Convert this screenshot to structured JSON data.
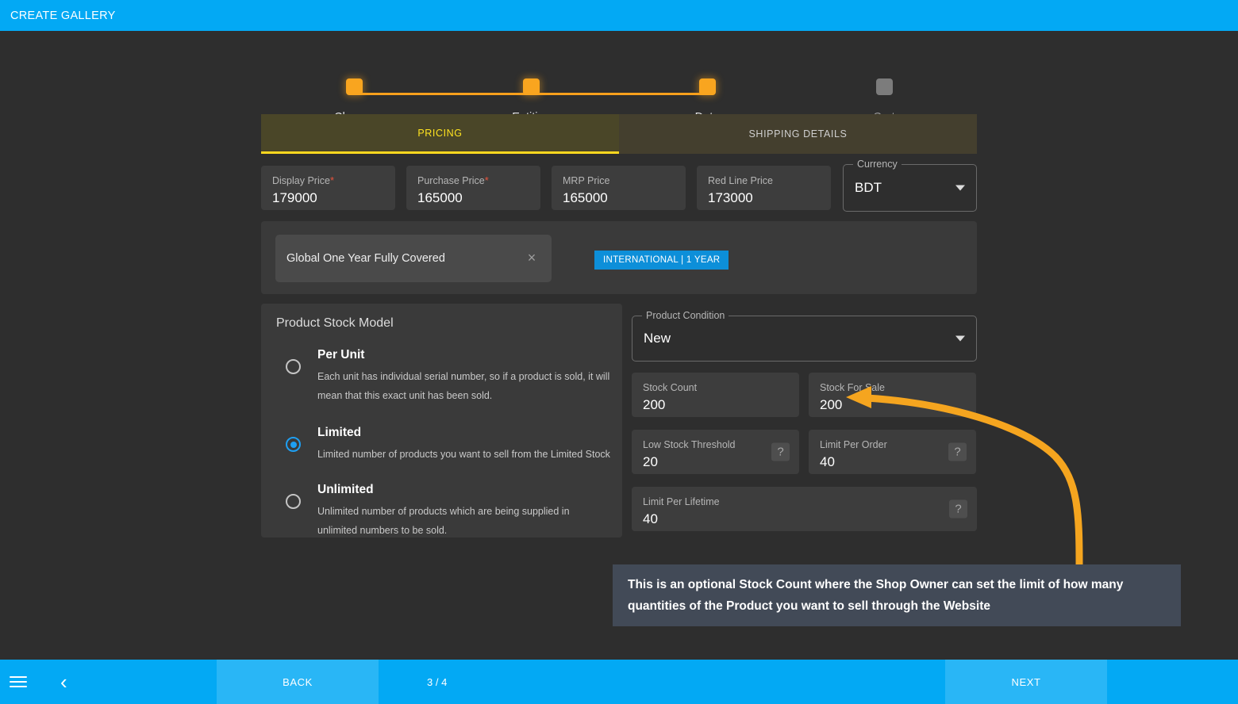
{
  "header": {
    "title": "CREATE GALLERY"
  },
  "stepper": {
    "steps": [
      {
        "label": "Choose",
        "state": "active"
      },
      {
        "label": "Entities",
        "state": "active"
      },
      {
        "label": "Data",
        "state": "active"
      },
      {
        "label": "Cart",
        "state": "inactive"
      }
    ]
  },
  "tabs": [
    {
      "label": "PRICING",
      "state": "active"
    },
    {
      "label": "SHIPPING DETAILS",
      "state": "inactive"
    }
  ],
  "pricing": {
    "display_price": {
      "label": "Display Price",
      "required": "*",
      "value": "179000"
    },
    "purchase_price": {
      "label": "Purchase Price",
      "required": "*",
      "value": "165000"
    },
    "mrp_price": {
      "label": "MRP Price",
      "value": "165000"
    },
    "red_line_price": {
      "label": "Red Line Price",
      "value": "173000"
    },
    "currency": {
      "label": "Currency",
      "value": "BDT"
    }
  },
  "warranty": {
    "chip_text": "Global One Year Fully Covered",
    "chip_close": "×",
    "badge": "INTERNATIONAL | 1 YEAR"
  },
  "stock_model": {
    "title": "Product Stock Model",
    "options": [
      {
        "title": "Per Unit",
        "description": "Each unit has individual serial number, so if a product is sold, it will mean that this exact unit has been sold.",
        "selected": false
      },
      {
        "title": "Limited",
        "description": "Limited number of products you want to sell from the Limited Stock",
        "selected": true
      },
      {
        "title": "Unlimited",
        "description": "Unlimited number of products which are being supplied in unlimited numbers to be sold.",
        "selected": false
      }
    ]
  },
  "stock_fields": {
    "product_condition": {
      "label": "Product Condition",
      "value": "New"
    },
    "stock_count": {
      "label": "Stock Count",
      "value": "200"
    },
    "stock_for_sale": {
      "label": "Stock For Sale",
      "value": "200"
    },
    "low_stock_threshold": {
      "label": "Low Stock Threshold",
      "value": "20",
      "help": "?"
    },
    "limit_per_order": {
      "label": "Limit Per Order",
      "value": "40",
      "help": "?"
    },
    "limit_per_lifetime": {
      "label": "Limit Per Lifetime",
      "value": "40",
      "help": "?"
    }
  },
  "annotation": {
    "text": "This is an optional Stock Count where the Shop Owner can set the limit of how many quantities of the Product you want to sell through the Website",
    "arrow_color": "#f5a51f"
  },
  "footer": {
    "menu_icon": "hamburger-icon",
    "back_icon": "‹",
    "back_label": "BACK",
    "page_indicator": "3 / 4",
    "next_label": "NEXT"
  },
  "colors": {
    "accent_blue": "#03a9f4",
    "stepper_orange": "#f9a51f",
    "tab_yellow": "#ffe31f",
    "radio_blue": "#1e9ff2",
    "badge_blue": "#0d8fd9"
  }
}
